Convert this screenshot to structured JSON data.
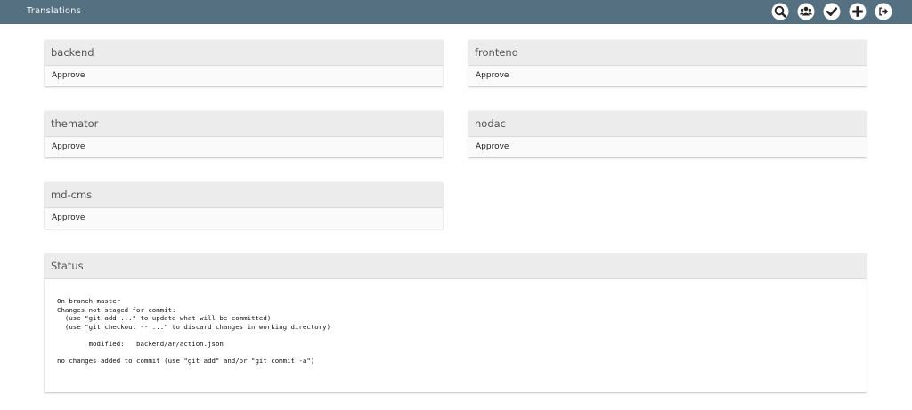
{
  "header": {
    "title": "Translations",
    "icons": [
      "search-icon",
      "users-icon",
      "check-icon",
      "plus-icon",
      "logout-icon"
    ]
  },
  "colors": {
    "topbar": "#557080",
    "panel_header": "#ececec",
    "panel_body": "#fafafa"
  },
  "projects": [
    {
      "name": "backend",
      "action": "Approve"
    },
    {
      "name": "frontend",
      "action": "Approve"
    },
    {
      "name": "themator",
      "action": "Approve"
    },
    {
      "name": "nodac",
      "action": "Approve"
    },
    {
      "name": "md-cms",
      "action": "Approve"
    }
  ],
  "status": {
    "title": "Status",
    "lines": [
      "On branch master",
      "Changes not staged for commit:",
      "  (use \"git add ...\" to update what will be committed)",
      "  (use \"git checkout -- ...\" to discard changes in working directory)",
      "",
      "        modified:   backend/ar/action.json",
      "",
      "no changes added to commit (use \"git add\" and/or \"git commit -a\")"
    ]
  }
}
